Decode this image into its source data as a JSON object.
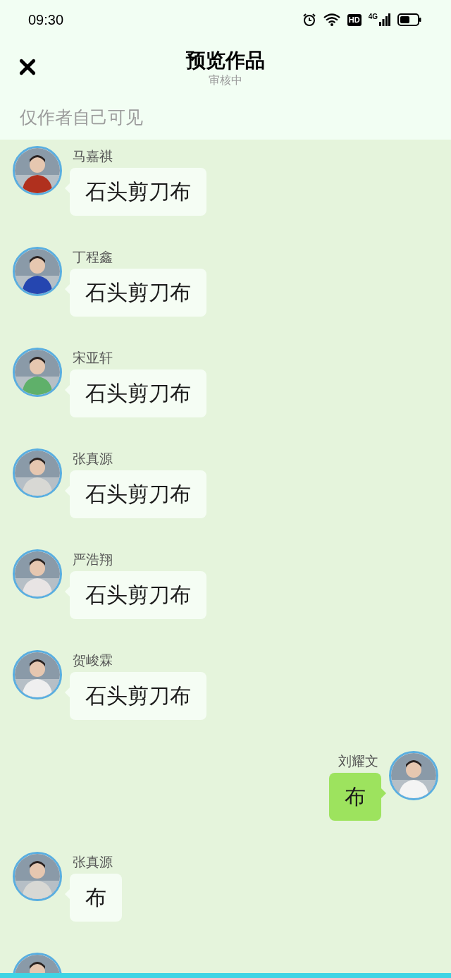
{
  "status_bar": {
    "time": "09:30",
    "hd_badge": "HD",
    "network": "4G"
  },
  "header": {
    "title": "预览作品",
    "subtitle": "审核中",
    "notice": "仅作者自己可见"
  },
  "messages": [
    {
      "kind": "received",
      "name": "马嘉祺",
      "text": "石头剪刀布"
    },
    {
      "kind": "received",
      "name": "丁程鑫",
      "text": "石头剪刀布"
    },
    {
      "kind": "received",
      "name": "宋亚轩",
      "text": "石头剪刀布"
    },
    {
      "kind": "received",
      "name": "张真源",
      "text": "石头剪刀布"
    },
    {
      "kind": "received",
      "name": "严浩翔",
      "text": "石头剪刀布"
    },
    {
      "kind": "received",
      "name": "贺峻霖",
      "text": "石头剪刀布"
    },
    {
      "kind": "sent",
      "name": "刘耀文",
      "text": "布"
    },
    {
      "kind": "received",
      "name": "张真源",
      "text": "布"
    },
    {
      "kind": "received"
    }
  ]
}
